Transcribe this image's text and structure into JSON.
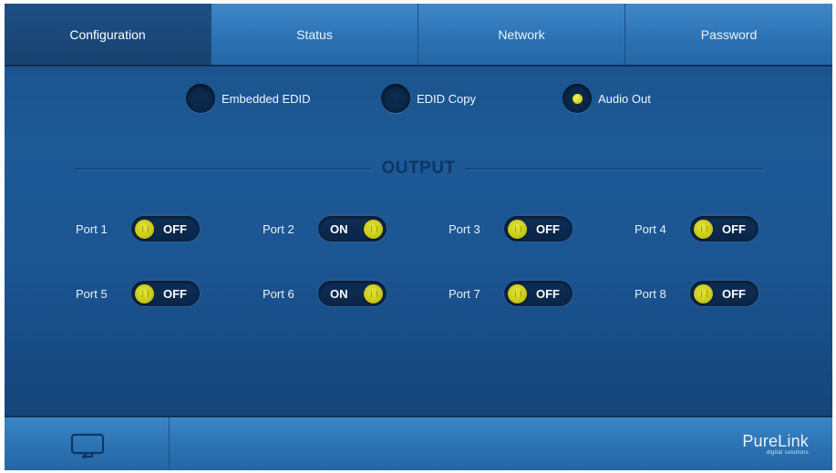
{
  "tabs": [
    {
      "label": "Configuration",
      "active": true
    },
    {
      "label": "Status",
      "active": false
    },
    {
      "label": "Network",
      "active": false
    },
    {
      "label": "Password",
      "active": false
    }
  ],
  "edid_options": [
    {
      "label": "Embedded EDID",
      "selected": false
    },
    {
      "label": "EDID Copy",
      "selected": false
    },
    {
      "label": "Audio Out",
      "selected": true
    }
  ],
  "output": {
    "heading": "OUTPUT",
    "ports": [
      {
        "label": "Port 1",
        "state": "OFF"
      },
      {
        "label": "Port 2",
        "state": "ON"
      },
      {
        "label": "Port 3",
        "state": "OFF"
      },
      {
        "label": "Port 4",
        "state": "OFF"
      },
      {
        "label": "Port 5",
        "state": "OFF"
      },
      {
        "label": "Port 6",
        "state": "ON"
      },
      {
        "label": "Port 7",
        "state": "OFF"
      },
      {
        "label": "Port 8",
        "state": "OFF"
      }
    ]
  },
  "footer": {
    "home_icon": "return-icon",
    "brand_name": "PureLink",
    "brand_tagline": "digital solutions"
  },
  "colors": {
    "background": "#1d5a97",
    "tab_active": "#17426f",
    "tab_inactive": "#2c73b4",
    "accent_yellow": "#d6d61a",
    "heading": "#0f3563"
  }
}
